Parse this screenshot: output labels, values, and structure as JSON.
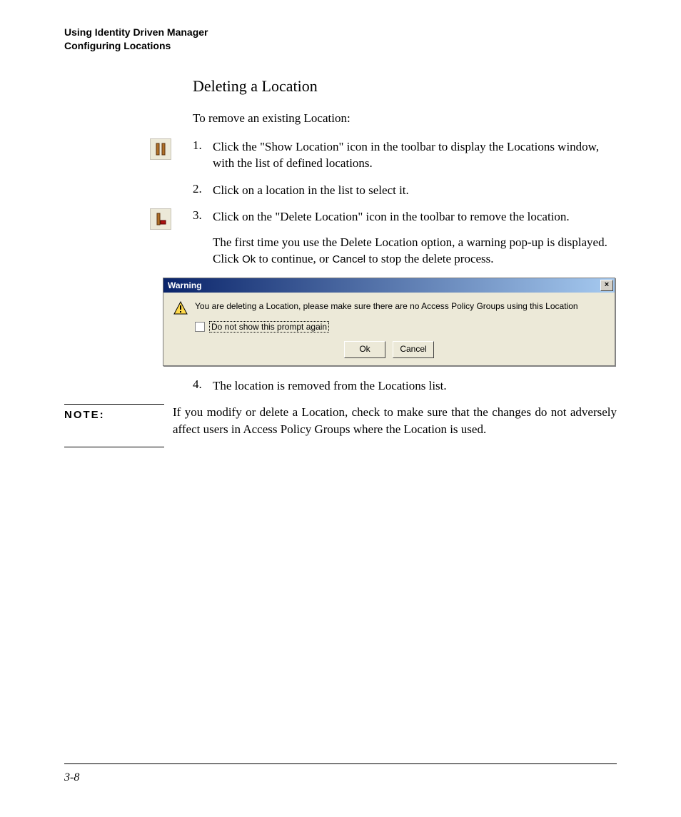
{
  "header": {
    "line1": "Using Identity Driven Manager",
    "line2": "Configuring Locations"
  },
  "section": {
    "title": "Deleting a Location",
    "intro": "To remove an existing Location:"
  },
  "steps": [
    {
      "num": "1.",
      "text": "Click the \"Show Location\" icon in the toolbar to display the Locations window, with the list of defined locations.",
      "icon": "show-location"
    },
    {
      "num": "2.",
      "text": "Click on a location in the list to select it."
    },
    {
      "num": "3.",
      "text": "Click on the  \"Delete Location\" icon in the toolbar to remove the location.",
      "extra_prefix": "The first time you use the Delete Location option, a warning pop-up is displayed. Click ",
      "ok_label": "Ok",
      "extra_mid": " to continue, or ",
      "cancel_label": "Cancel",
      "extra_suffix": " to stop the delete process.",
      "icon": "delete-location"
    },
    {
      "num": "4.",
      "text": "The location is removed from the Locations list."
    }
  ],
  "dialog": {
    "title": "Warning",
    "close": "×",
    "message": "You are deleting a Location, please make sure there are no Access Policy Groups using this Location",
    "checkbox_label": "Do not show this prompt again",
    "ok": "Ok",
    "cancel": "Cancel"
  },
  "note": {
    "label": "NOTE:",
    "text": "If you modify or delete a Location, check to make sure that the changes do not adversely affect users in Access Policy Groups where the Location is used."
  },
  "footer": {
    "page": "3-8"
  }
}
